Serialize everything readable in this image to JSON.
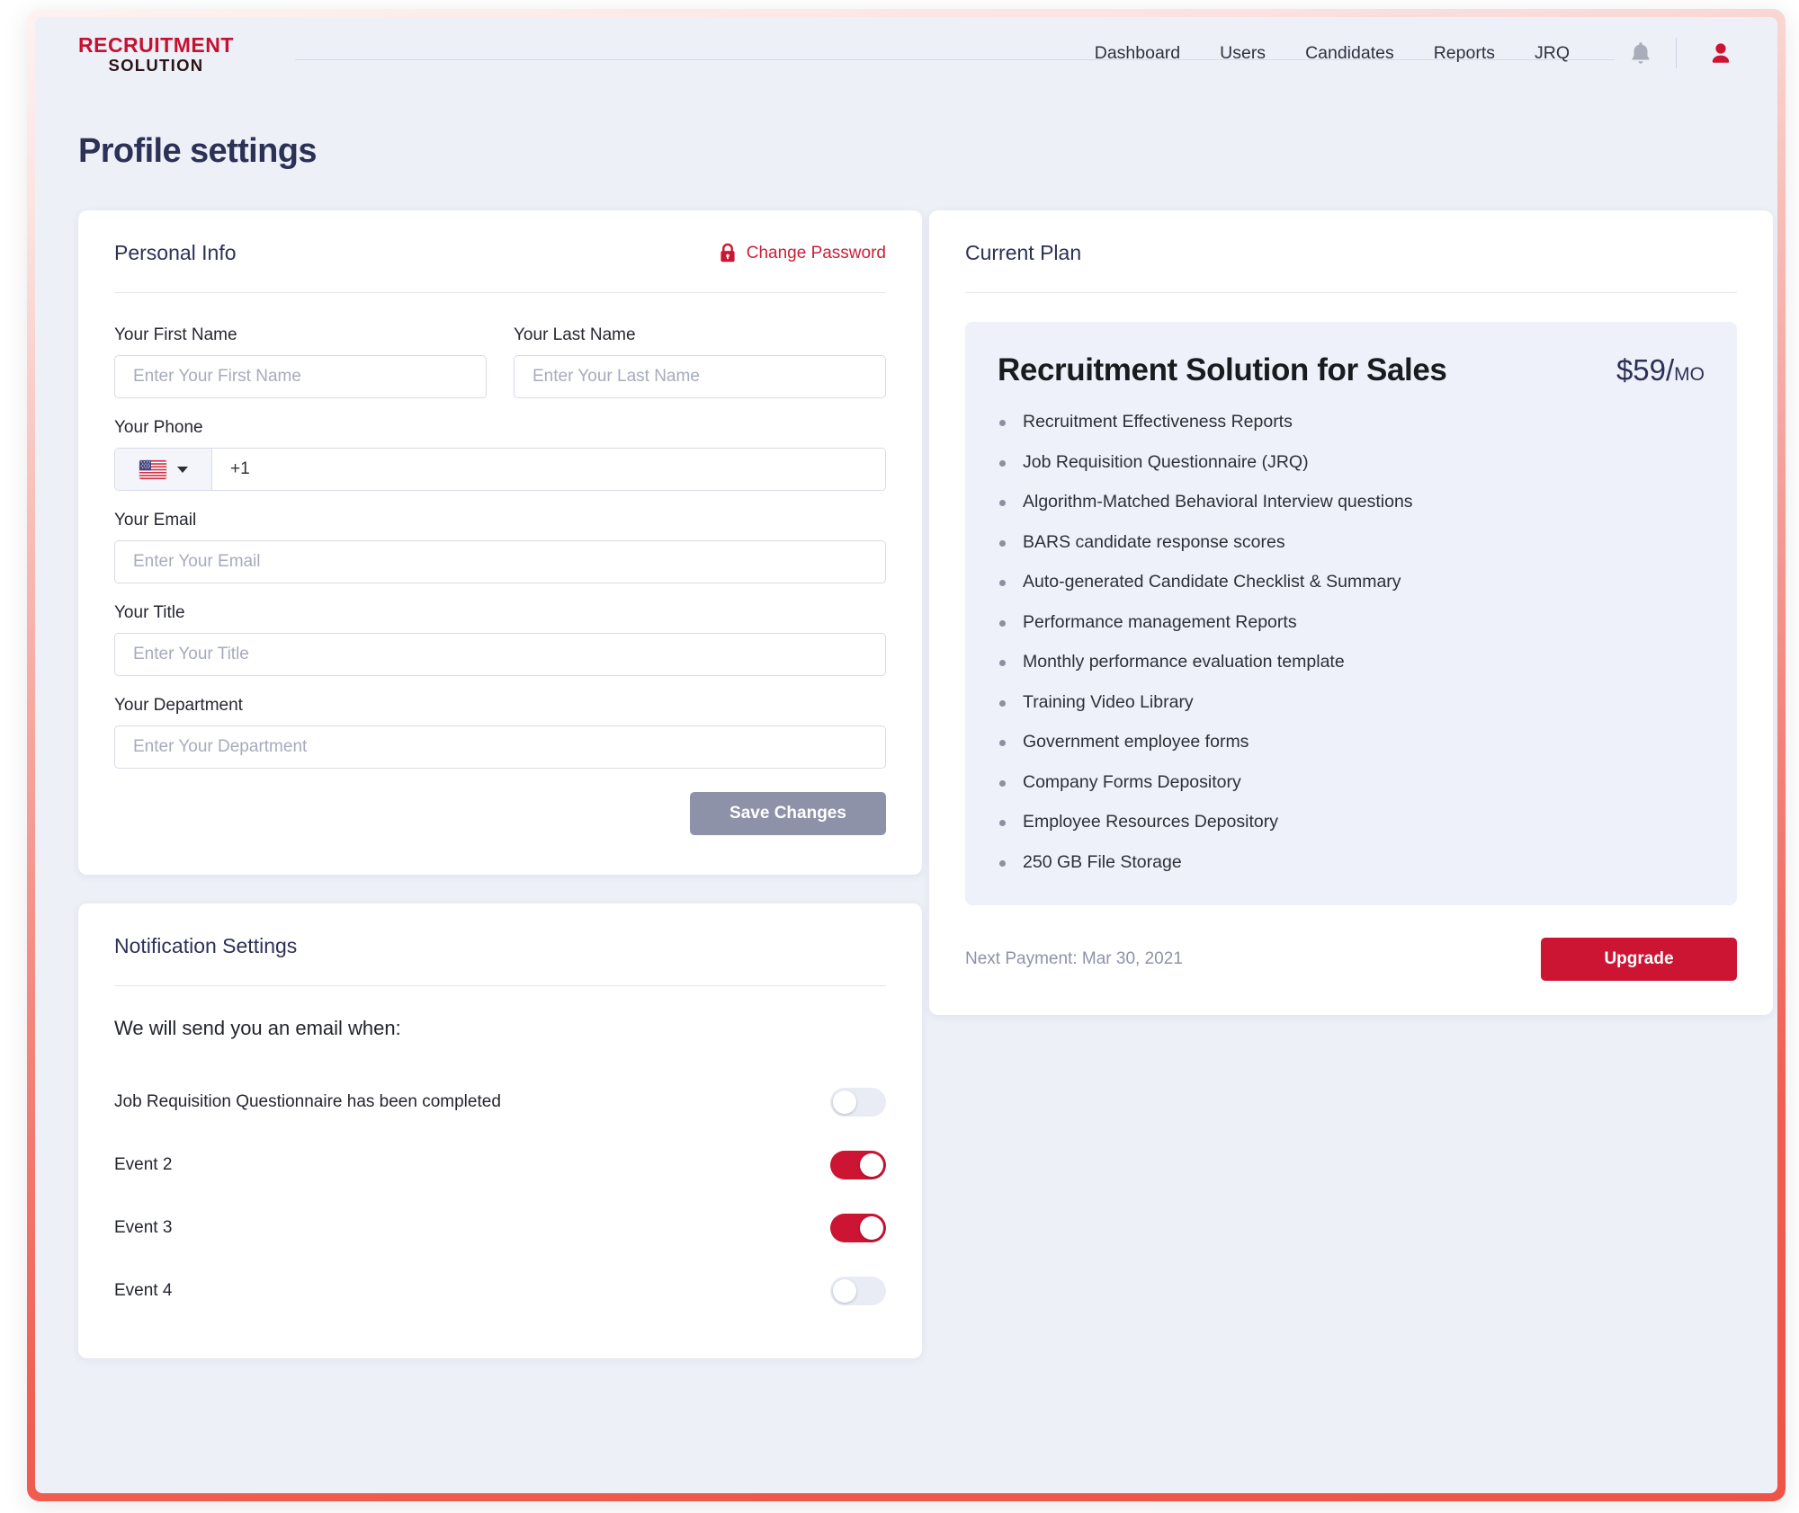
{
  "brand": {
    "line1": "RECRUITMENT",
    "line2": "SOLUTION",
    "color": "#c41230"
  },
  "nav": {
    "links": [
      "Dashboard",
      "Users",
      "Candidates",
      "Reports",
      "JRQ"
    ],
    "bell_icon": "bell-icon",
    "avatar_icon": "user-avatar-icon"
  },
  "page": {
    "title": "Profile settings"
  },
  "personal_info": {
    "title": "Personal Info",
    "change_password": "Change Password",
    "lock_icon": "lock-icon",
    "fields": [
      {
        "label": "Your First Name",
        "placeholder": "Enter Your First Name",
        "value": ""
      },
      {
        "label": "Your Last Name",
        "placeholder": "Enter Your Last Name",
        "value": ""
      },
      {
        "label": "Your Phone",
        "placeholder": "",
        "value": "+1"
      },
      {
        "label": "Your Email",
        "placeholder": "Enter Your Email",
        "value": ""
      },
      {
        "label": "Your Title",
        "placeholder": "Enter Your Title",
        "value": ""
      },
      {
        "label": "Your Department",
        "placeholder": "Enter Your Department",
        "value": ""
      }
    ],
    "phone_country": "US",
    "save_label": "Save Changes",
    "save_color": "#8d92a8"
  },
  "current_plan": {
    "title": "Current Plan",
    "plan_name": "Recruitment Solution for Sales",
    "price_amount": "$59/",
    "price_period": "MO",
    "features": [
      "Recruitment Effectiveness Reports",
      "Job Requisition Questionnaire (JRQ)",
      "Algorithm-Matched Behavioral Interview questions",
      "BARS candidate response scores",
      "Auto-generated Candidate Checklist & Summary",
      "Performance management Reports",
      "Monthly performance evaluation template",
      "Training Video Library",
      "Government employee forms",
      "Company Forms Depository",
      "Employee Resources Depository",
      "250 GB File Storage"
    ],
    "next_payment": "Next Payment: Mar 30, 2021",
    "upgrade_label": "Upgrade",
    "upgrade_color": "#cc1433"
  },
  "notifications": {
    "title": "Notification Settings",
    "intro": "We will send you an email when:",
    "rows": [
      {
        "label": "Job Requisition Questionnaire has been completed",
        "on": false
      },
      {
        "label": "Event 2",
        "on": true
      },
      {
        "label": "Event 3",
        "on": true
      },
      {
        "label": "Event 4",
        "on": false
      }
    ]
  }
}
